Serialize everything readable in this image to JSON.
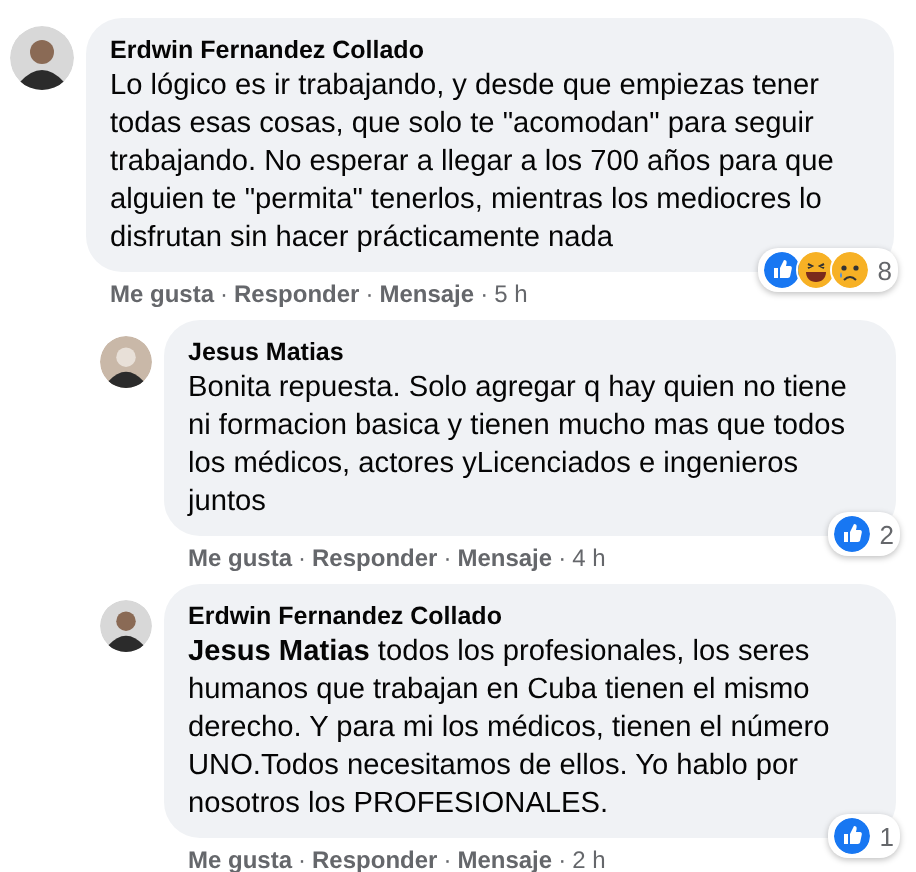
{
  "comments": [
    {
      "kind": "top",
      "author": "Erdwin Fernandez Collado",
      "text": "Lo lógico es ir trabajando, y desde que empiezas tener todas esas cosas, que solo te \"acomodan\" para seguir trabajando. No esperar a llegar a los 700 años para que alguien te \"permita\" tenerlos, mientras los mediocres lo disfrutan sin hacer prácticamente nada",
      "reactions": [
        {
          "kind": "like"
        },
        {
          "kind": "haha"
        },
        {
          "kind": "sad"
        }
      ],
      "reaction_count": "8",
      "separator": "·",
      "actions": [
        "Me gusta",
        "Responder",
        "Mensaje"
      ],
      "time": "5 h"
    },
    {
      "kind": "reply",
      "author": "Jesus Matias",
      "text": "Bonita repuesta. Solo agregar q hay quien no tiene ni formacion basica y tienen mucho mas que todos los médicos, actores yLicenciados e ingenieros juntos",
      "reactions": [
        {
          "kind": "like"
        }
      ],
      "reaction_count": "2",
      "separator": "·",
      "actions": [
        "Me gusta",
        "Responder",
        "Mensaje"
      ],
      "time": "4 h"
    },
    {
      "kind": "reply",
      "author": "Erdwin Fernandez Collado",
      "text": "**Jesus Matias** todos los profesionales, los seres humanos que trabajan en Cuba tienen el mismo derecho. Y para mi los médicos, tienen el número UNO.Todos necesitamos de ellos. Yo hablo por nosotros los PROFESIONALES.",
      "reactions": [
        {
          "kind": "like"
        }
      ],
      "reaction_count": "1",
      "separator": "·",
      "actions": [
        "Me gusta",
        "Responder",
        "Mensaje"
      ],
      "time": "2 h"
    }
  ]
}
